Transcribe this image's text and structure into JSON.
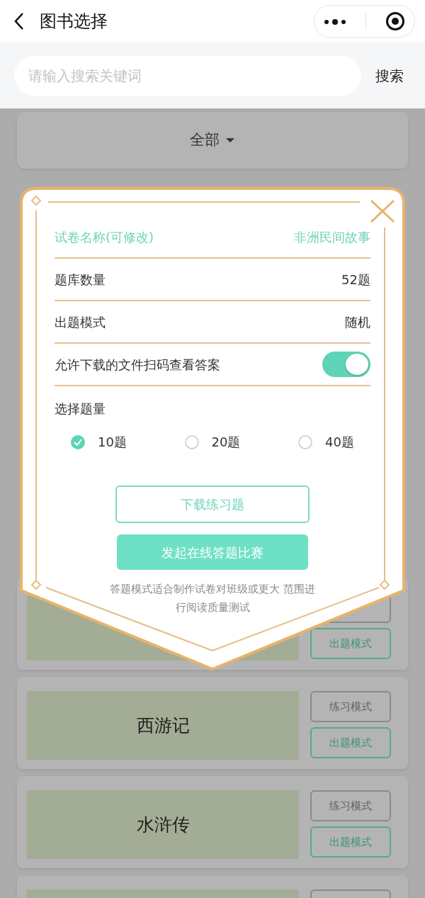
{
  "header": {
    "title": "图书选择"
  },
  "search": {
    "placeholder": "请输入搜索关键词",
    "button": "搜索"
  },
  "filter": {
    "label": "全部"
  },
  "books": [
    {
      "exam_label": "出题模式"
    },
    {
      "title": "西游记",
      "practice_label": "练习模式",
      "exam_label": "出题模式"
    },
    {
      "title": "水浒传",
      "practice_label": "练习模式",
      "exam_label": "出题模式"
    }
  ],
  "list_continues": true,
  "dialog": {
    "fields": [
      {
        "kind": "editable",
        "label": "试卷名称(可修改)",
        "value": "非洲民间故事"
      },
      {
        "kind": "info",
        "label": "题库数量",
        "value": "52题"
      },
      {
        "kind": "info",
        "label": "出题模式",
        "value": "随机"
      },
      {
        "kind": "toggle",
        "label": "允许下载的文件扫码查看答案",
        "on": true
      }
    ],
    "count_label": "选择题量",
    "counts": [
      {
        "label": "10题",
        "selected": true
      },
      {
        "label": "20题",
        "selected": false
      },
      {
        "label": "40题",
        "selected": false
      }
    ],
    "download_button": "下载练习题",
    "start_button": "发起在线答题比赛",
    "note": "答题模式适合制作试卷对班级或更大 范围进行阅读质量测试"
  }
}
